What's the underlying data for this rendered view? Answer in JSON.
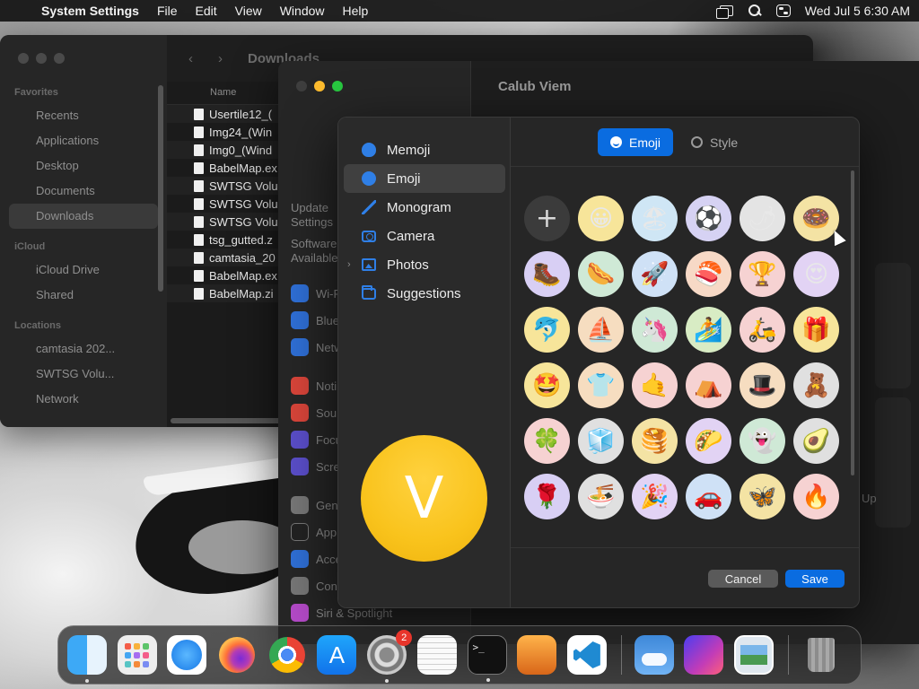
{
  "menubar": {
    "app_name": "System Settings",
    "menus": [
      "File",
      "Edit",
      "View",
      "Window",
      "Help"
    ],
    "datetime": "Wed Jul 5  6:30 AM"
  },
  "finder": {
    "title": "Downloads",
    "sidebar": {
      "favorites_header": "Favorites",
      "favorites": [
        "Recents",
        "Applications",
        "Desktop",
        "Documents",
        "Downloads"
      ],
      "icloud_header": "iCloud",
      "icloud": [
        "iCloud Drive",
        "Shared"
      ],
      "locations_header": "Locations",
      "locations": [
        "camtasia 202...",
        "SWTSG Volu...",
        "Network"
      ]
    },
    "column_name": "Name",
    "files": [
      "Usertile12_(",
      "Img24_(Win",
      "Img0_(Wind",
      "BabelMap.ex",
      "SWTSG Volu",
      "SWTSG Volu",
      "SWTSG Volu",
      "tsg_gutted.z",
      "camtasia_20",
      "BabelMap.ex",
      "BabelMap.zi"
    ]
  },
  "settings": {
    "title": "Calub Viem",
    "sidebar_items": [
      "Update",
      "Settings",
      "Software",
      "Available",
      "Wi-Fi",
      "Blue",
      "Netw",
      "Noti",
      "Sou",
      "Focu",
      "Scre",
      "Gen",
      "App",
      "Acce",
      "Con",
      "Siri & Spotlight"
    ],
    "right_text": "Up"
  },
  "dialog": {
    "nav": [
      {
        "label": "Memoji",
        "icon": "memoji-icon"
      },
      {
        "label": "Emoji",
        "icon": "emoji-icon"
      },
      {
        "label": "Monogram",
        "icon": "monogram-icon"
      },
      {
        "label": "Camera",
        "icon": "camera-icon"
      },
      {
        "label": "Photos",
        "icon": "photos-icon"
      },
      {
        "label": "Suggestions",
        "icon": "folder-icon"
      }
    ],
    "selected_nav": "Emoji",
    "preview_letter": "V",
    "preview_color": "#f9c31c",
    "tabs": {
      "emoji": "Emoji",
      "style": "Style"
    },
    "active_tab": "Emoji",
    "add_symbol": "+",
    "emoji_rows": [
      [
        "😀",
        "🏖",
        "⚽",
        "🌶",
        "🍩"
      ],
      [
        "🥾",
        "🌭",
        "🚀",
        "🍣",
        "🏆",
        "😍"
      ],
      [
        "🐬",
        "⛵",
        "🦄",
        "🏄",
        "🛵",
        "🎁"
      ],
      [
        "🤩",
        "👕",
        "🤙",
        "⛺",
        "🎩",
        "🧸"
      ],
      [
        "🍀",
        "🧊",
        "🥞",
        "🌮",
        "👻",
        "🥑"
      ],
      [
        "🌹",
        "🍜",
        "🎉",
        "🚗",
        "🦋",
        "🔥"
      ]
    ],
    "emoji_bg_colors": [
      [
        "#f7e59a",
        "#cfe6f5",
        "#d6d2f3",
        "#e4e4e4",
        "#f4e3a4"
      ],
      [
        "#d8cff4",
        "#cfe9d6",
        "#cfe1f6",
        "#f7d9c6",
        "#f6d2d2",
        "#e2d3f4"
      ],
      [
        "#f7e59a",
        "#f6ddc0",
        "#cfe9d6",
        "#d8ecc4",
        "#f6d2d2",
        "#f7e59a"
      ],
      [
        "#f7e59a",
        "#f6ddc0",
        "#f6d2d2",
        "#f6d2d2",
        "#f6ddc0",
        "#e0e0e0"
      ],
      [
        "#f6d2d2",
        "#e0e0e0",
        "#f4e3a4",
        "#e2d3f4",
        "#cfe9d6",
        "#e0e0e0"
      ],
      [
        "#d8cff4",
        "#e0e0e0",
        "#e2d3f4",
        "#cfe1f6",
        "#f4e3a4",
        "#f6d2d2"
      ]
    ],
    "cancel_label": "Cancel",
    "save_label": "Save",
    "accent_color": "#0a6ce0"
  },
  "dock": {
    "apps": [
      "finder-icon",
      "launchpad-icon",
      "safari-icon",
      "firefox-icon",
      "chrome-icon",
      "app-store-icon",
      "system-settings-icon",
      "textedit-icon",
      "terminal-icon",
      "garageband-icon",
      "vscode-icon",
      "weather-icon",
      "shortcuts-icon",
      "preview-icon",
      "trash-icon"
    ],
    "settings_badge": "2",
    "terminal_prompt": ">_"
  }
}
